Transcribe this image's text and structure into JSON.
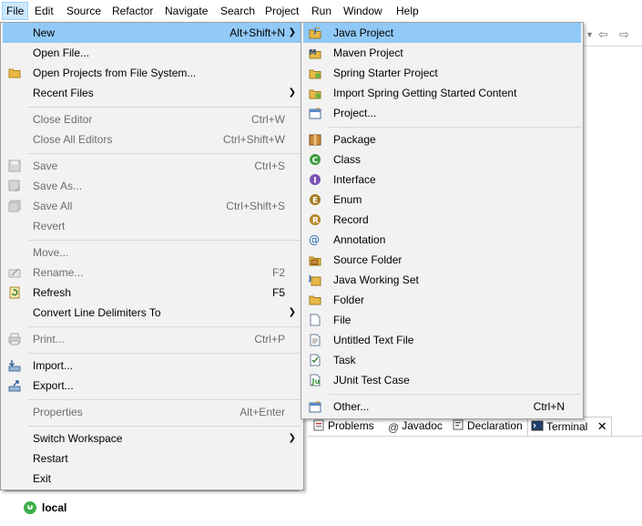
{
  "menubar": {
    "items": [
      {
        "label": "File",
        "active": true
      },
      {
        "label": "Edit"
      },
      {
        "label": "Source"
      },
      {
        "label": "Refactor"
      },
      {
        "label": "Navigate"
      },
      {
        "label": "Search"
      },
      {
        "label": "Project"
      },
      {
        "label": "Run"
      },
      {
        "label": "Window"
      },
      {
        "label": "Help"
      }
    ]
  },
  "file_menu": {
    "new": {
      "label": "New",
      "accel": "Alt+Shift+N"
    },
    "open_file": {
      "label": "Open File..."
    },
    "open_projects": {
      "label": "Open Projects from File System..."
    },
    "recent_files": {
      "label": "Recent Files"
    },
    "close_editor": {
      "label": "Close Editor",
      "accel": "Ctrl+W"
    },
    "close_all_editors": {
      "label": "Close All Editors",
      "accel": "Ctrl+Shift+W"
    },
    "save": {
      "label": "Save",
      "accel": "Ctrl+S"
    },
    "save_as": {
      "label": "Save As..."
    },
    "save_all": {
      "label": "Save All",
      "accel": "Ctrl+Shift+S"
    },
    "revert": {
      "label": "Revert"
    },
    "move": {
      "label": "Move..."
    },
    "rename": {
      "label": "Rename...",
      "accel": "F2"
    },
    "refresh": {
      "label": "Refresh",
      "accel": "F5"
    },
    "convert_line_delimiters": {
      "label": "Convert Line Delimiters To"
    },
    "print": {
      "label": "Print...",
      "accel": "Ctrl+P"
    },
    "import": {
      "label": "Import..."
    },
    "export": {
      "label": "Export..."
    },
    "properties": {
      "label": "Properties",
      "accel": "Alt+Enter"
    },
    "switch_workspace": {
      "label": "Switch Workspace"
    },
    "restart": {
      "label": "Restart"
    },
    "exit": {
      "label": "Exit"
    }
  },
  "new_submenu": {
    "java_project": {
      "label": "Java Project"
    },
    "maven_project": {
      "label": "Maven Project"
    },
    "spring_starter_project": {
      "label": "Spring Starter Project"
    },
    "import_spring_content": {
      "label": "Import Spring Getting Started Content"
    },
    "project": {
      "label": "Project..."
    },
    "package": {
      "label": "Package"
    },
    "class": {
      "label": "Class"
    },
    "interface": {
      "label": "Interface"
    },
    "enum": {
      "label": "Enum"
    },
    "record": {
      "label": "Record"
    },
    "annotation": {
      "label": "Annotation"
    },
    "source_folder": {
      "label": "Source Folder"
    },
    "java_working_set": {
      "label": "Java Working Set"
    },
    "folder": {
      "label": "Folder"
    },
    "file": {
      "label": "File"
    },
    "untitled_text_file": {
      "label": "Untitled Text File"
    },
    "task": {
      "label": "Task"
    },
    "junit_test_case": {
      "label": "JUnit Test Case"
    },
    "other": {
      "label": "Other...",
      "accel": "Ctrl+N"
    }
  },
  "bottom_tabs": [
    {
      "label": "Problems",
      "icon": "problems-icon"
    },
    {
      "label": "Javadoc",
      "icon": "at-sign-icon"
    },
    {
      "label": "Declaration",
      "icon": "declaration-icon"
    },
    {
      "label": "Terminal",
      "icon": "terminal-icon",
      "selected": true
    }
  ],
  "servers": {
    "local_label": "local"
  },
  "colors": {
    "highlight": "#91c9f7",
    "menu_bg": "#f2f2f2",
    "menubar_active": "#cce8ff"
  }
}
